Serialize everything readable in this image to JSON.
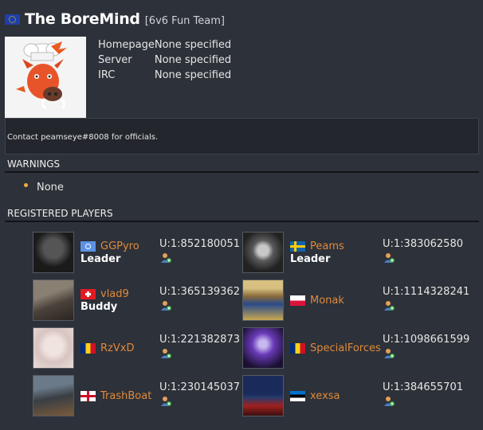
{
  "team": {
    "name": "The BoreMind",
    "tag": "[6v6 Fun Team]",
    "flag_icon": "eu-flag-icon",
    "logo_icon": "boar-with-chef-hat-logo"
  },
  "info": [
    {
      "label": "Homepage",
      "value": "None specified"
    },
    {
      "label": "Server",
      "value": "None specified"
    },
    {
      "label": "IRC",
      "value": "None specified"
    }
  ],
  "contact": "Contact peamseye#8008 for officials.",
  "warnings": {
    "title": "WARNINGS",
    "items": [
      "None"
    ]
  },
  "players_section": {
    "title": "REGISTERED PLAYERS"
  },
  "players": [
    {
      "name": "GGPyro",
      "flag": "un-flag-icon",
      "role": "Leader",
      "steam_id": "U:1:852180051"
    },
    {
      "name": "Peams",
      "flag": "se-flag-icon",
      "role": "Leader",
      "steam_id": "U:1:383062580"
    },
    {
      "name": "vlad9",
      "flag": "ch-flag-icon",
      "role": "Buddy",
      "steam_id": "U:1:365139362"
    },
    {
      "name": "Monak",
      "flag": "pl-flag-icon",
      "role": "",
      "steam_id": "U:1:1114328241"
    },
    {
      "name": "RzVxD",
      "flag": "ro-flag-icon",
      "role": "",
      "steam_id": "U:1:221382873"
    },
    {
      "name": "SpecialForces",
      "flag": "ro-flag-icon",
      "role": "",
      "steam_id": "U:1:1098661599"
    },
    {
      "name": "TrashBoat",
      "flag": "en-flag-icon",
      "role": "",
      "steam_id": "U:1:230145037"
    },
    {
      "name": "xexsa",
      "flag": "ee-flag-icon",
      "role": "",
      "steam_id": "U:1:384655701"
    }
  ],
  "colors": {
    "background": "#2d3139",
    "link": "#e08a3c",
    "bullet": "#f5a840"
  }
}
